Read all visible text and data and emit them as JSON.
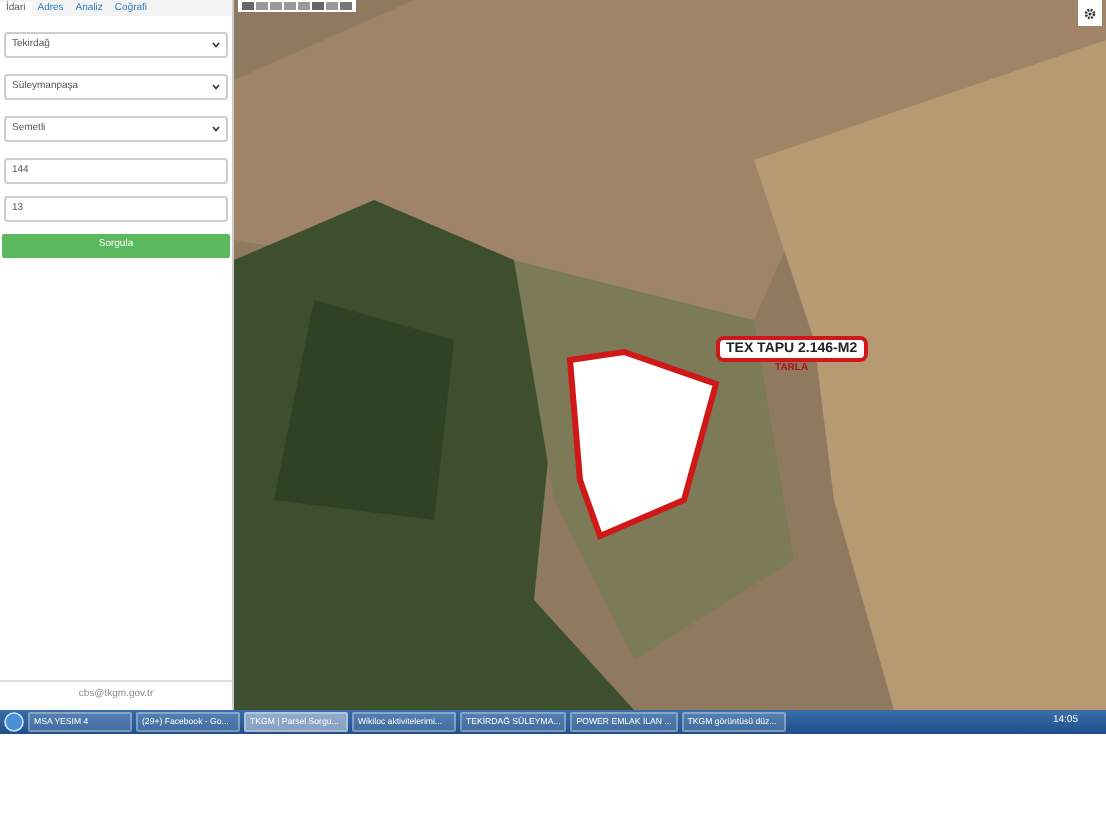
{
  "sidebar": {
    "tabs": [
      {
        "label": "İdari",
        "selected": true
      },
      {
        "label": "Adres",
        "selected": false
      },
      {
        "label": "Analiz",
        "selected": false
      },
      {
        "label": "Coğrafi",
        "selected": false
      }
    ],
    "fields": [
      {
        "kind": "select",
        "value": "Tekirdağ"
      },
      {
        "kind": "select",
        "value": "Süleymanpaşa"
      },
      {
        "kind": "select",
        "value": "Semetli"
      },
      {
        "kind": "input",
        "value": "144"
      },
      {
        "kind": "input",
        "value": "13"
      }
    ],
    "button": "Sorgula",
    "footer": "cbs@tkgm.gov.tr"
  },
  "map": {
    "parcel_label": {
      "title": "TEX TAPU 2.146-M2",
      "subtitle": "TARLA"
    }
  },
  "taskbar": {
    "items": [
      {
        "label": "MSA YESIM 4",
        "active": false
      },
      {
        "label": "(29+) Facebook - Go...",
        "active": false
      },
      {
        "label": "TKGM | Parsel Sorgu...",
        "active": true
      },
      {
        "label": "Wikiloc aktivitelerimi...",
        "active": false
      },
      {
        "label": "TEKİRDAĞ SÜLEYMA...",
        "active": false
      },
      {
        "label": "POWER EMLAK İLAN ...",
        "active": false
      },
      {
        "label": "TKGM görüntüsü düz...",
        "active": false
      }
    ],
    "clock": "14:05"
  }
}
